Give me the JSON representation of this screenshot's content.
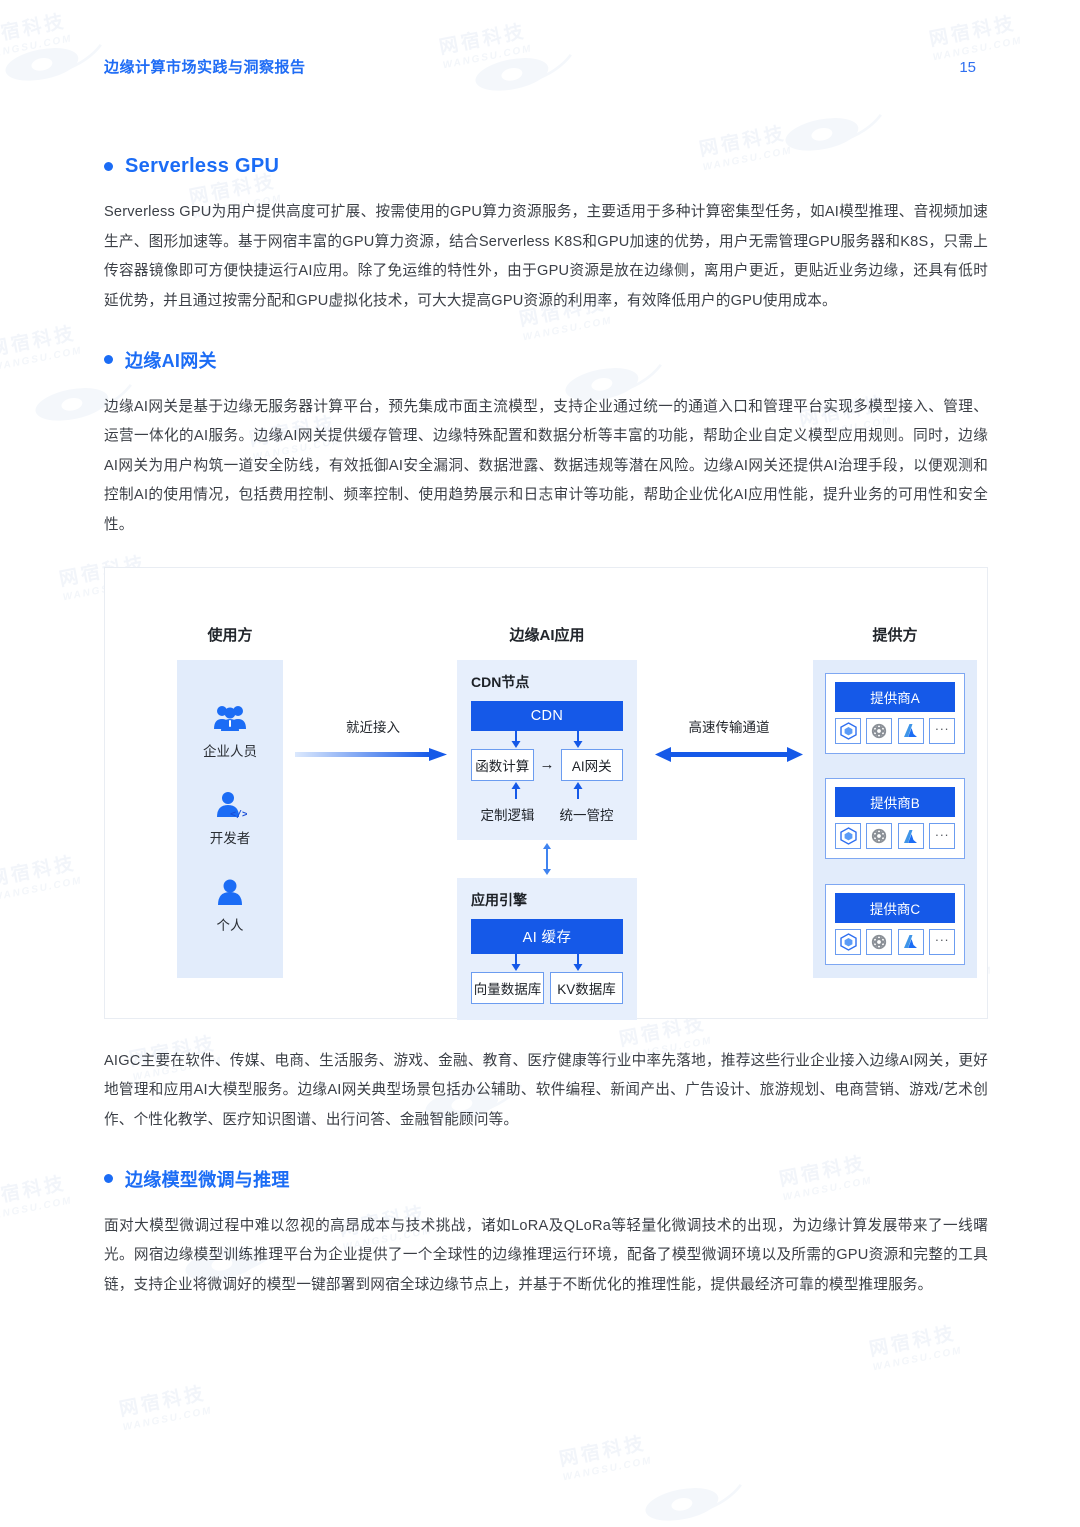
{
  "header": {
    "title": "边缘计算市场实践与洞察报告",
    "page_number": "15"
  },
  "watermark": {
    "text_cn": "网宿科技",
    "text_en": "WANGSU.COM"
  },
  "sections": [
    {
      "heading": "Serverless GPU",
      "body": "Serverless GPU为用户提供高度可扩展、按需使用的GPU算力资源服务，主要适用于多种计算密集型任务，如AI模型推理、音视频加速生产、图形加速等。基于网宿丰富的GPU算力资源，结合Serverless K8S和GPU加速的优势，用户无需管理GPU服务器和K8S，只需上传容器镜像即可方便快捷运行AI应用。除了免运维的特性外，由于GPU资源是放在边缘侧，离用户更近，更贴近业务边缘，还具有低时延优势，并且通过按需分配和GPU虚拟化技术，可大大提高GPU资源的利用率，有效降低用户的GPU使用成本。"
    },
    {
      "heading": "边缘AI网关",
      "body": "边缘AI网关是基于边缘无服务器计算平台，预先集成市面主流模型，支持企业通过统一的通道入口和管理平台实现多模型接入、管理、运营一体化的AI服务。边缘AI网关提供缓存管理、边缘特殊配置和数据分析等丰富的功能，帮助企业自定义模型应用规则。同时，边缘AI网关为用户构筑一道安全防线，有效抵御AI安全漏洞、数据泄露、数据违规等潜在风险。边缘AI网关还提供AI治理手段，以便观测和控制AI的使用情况，包括费用控制、频率控制、使用趋势展示和日志审计等功能，帮助企业优化AI应用性能，提升业务的可用性和安全性。"
    },
    {
      "heading": "边缘模型微调与推理",
      "body": "面对大模型微调过程中难以忽视的高昂成本与技术挑战，诸如LoRA及QLoRa等轻量化微调技术的出现，为边缘计算发展带来了一线曙光。网宿边缘模型训练推理平台为企业提供了一个全球性的边缘推理运行环境，配备了模型微调环境以及所需的GPU资源和完整的工具链，支持企业将微调好的模型一键部署到网宿全球边缘节点上，并基于不断优化的推理性能，提供最经济可靠的模型推理服务。"
    }
  ],
  "aigc_paragraph": "AIGC主要在软件、传媒、电商、生活服务、游戏、金融、教育、医疗健康等行业中率先落地，推荐这些行业企业接入边缘AI网关，更好地管理和应用AI大模型服务。边缘AI网关典型场景包括办公辅助、软件编程、新闻产出、广告设计、旅游规划、电商营销、游戏/艺术创作、个性化教学、医疗知识图谱、出行问答、金融智能顾问等。",
  "diagram": {
    "columns": {
      "users_title": "使用方",
      "app_title": "边缘AI应用",
      "providers_title": "提供方"
    },
    "users": [
      {
        "label": "企业人员",
        "icon": "group-users-icon"
      },
      {
        "label": "开发者",
        "icon": "developer-code-icon"
      },
      {
        "label": "个人",
        "icon": "single-user-icon"
      }
    ],
    "flows": {
      "left_label": "就近接入",
      "right_label": "高速传输通道"
    },
    "cdn_node": {
      "title": "CDN节点",
      "bar": "CDN",
      "boxes": [
        "函数计算",
        "AI网关"
      ],
      "connector": "→",
      "sub_labels": [
        "定制逻辑",
        "统一管控"
      ]
    },
    "app_engine": {
      "title": "应用引擎",
      "bar": "AI 缓存",
      "boxes": [
        "向量数据库",
        "KV数据库"
      ]
    },
    "providers": [
      {
        "name": "提供商A",
        "icons": [
          "cube-model-icon",
          "openai-swirl-icon",
          "azure-a-icon",
          "more-ellipsis-icon"
        ],
        "more": "···"
      },
      {
        "name": "提供商B",
        "icons": [
          "cube-model-icon",
          "openai-swirl-icon",
          "azure-a-icon",
          "more-ellipsis-icon"
        ],
        "more": "···"
      },
      {
        "name": "提供商C",
        "icons": [
          "cube-model-icon",
          "openai-swirl-icon",
          "azure-a-icon",
          "more-ellipsis-icon"
        ],
        "more": "···"
      }
    ]
  },
  "colors": {
    "accent_blue": "#1b6cf5",
    "bar_blue": "#1559e8",
    "panel_blue": "#e2ecfb",
    "panel_blue_light": "#e7effc",
    "body_text": "#3b3f46"
  }
}
